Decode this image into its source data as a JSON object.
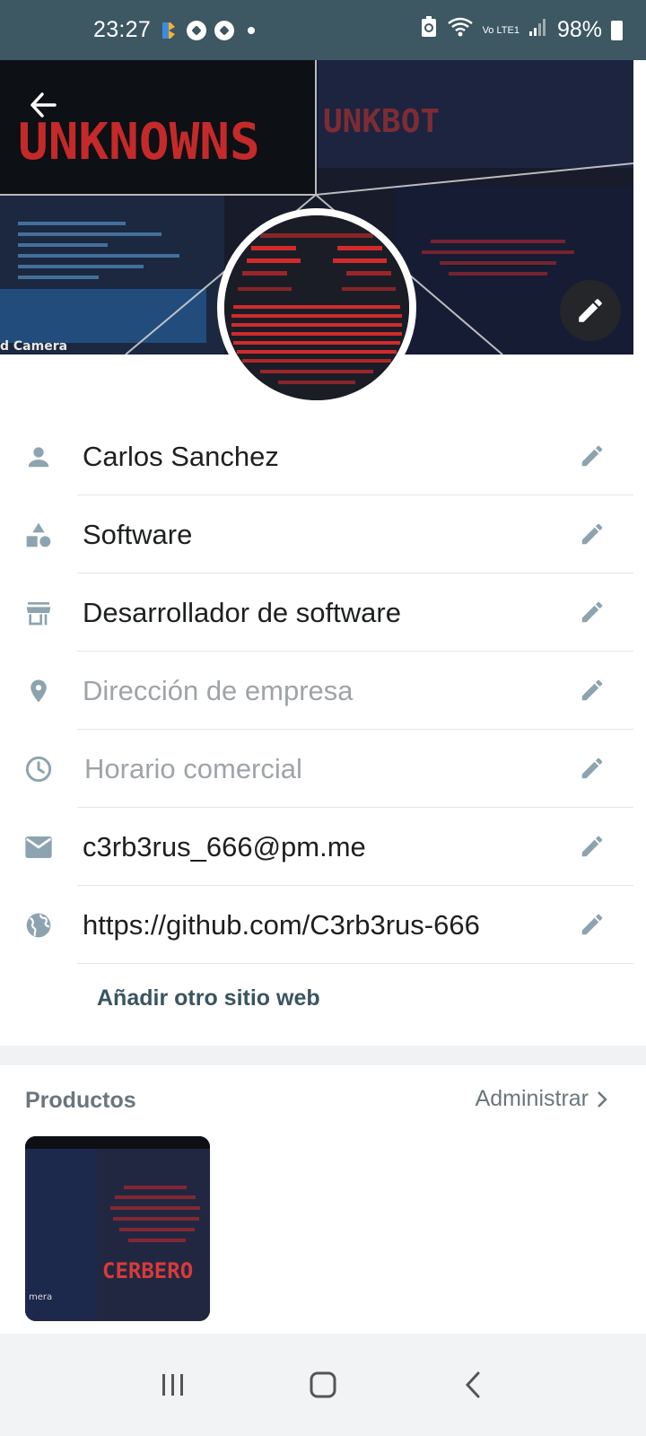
{
  "status": {
    "time": "23:27",
    "battery": "98%",
    "network_label": "Vo LTE1"
  },
  "profile": {
    "fields": [
      {
        "key": "name",
        "value": "Carlos Sanchez",
        "icon": "person-icon",
        "placeholder": false
      },
      {
        "key": "category",
        "value": "Software",
        "icon": "category-shapes-icon",
        "placeholder": false
      },
      {
        "key": "description",
        "value": "Desarrollador  de software",
        "icon": "store-icon",
        "placeholder": false
      },
      {
        "key": "address",
        "value": "Dirección de empresa",
        "icon": "location-pin-icon",
        "placeholder": true
      },
      {
        "key": "hours",
        "value": "Horario comercial",
        "icon": "clock-icon",
        "placeholder": true
      },
      {
        "key": "email",
        "value": "c3rb3rus_666@pm.me",
        "icon": "mail-icon",
        "placeholder": false
      },
      {
        "key": "website",
        "value": "https://github.com/C3rb3rus-666",
        "icon": "globe-icon",
        "placeholder": false
      }
    ],
    "add_website_label": "Añadir otro sitio web"
  },
  "products": {
    "title": "Productos",
    "manage_label": "Administrar"
  },
  "colors": {
    "status_bar": "#3d5763",
    "icon_gray": "#8da3b0",
    "link_dark": "#3a5560",
    "text_primary": "#1d1f20",
    "placeholder": "#9ea4a8"
  }
}
